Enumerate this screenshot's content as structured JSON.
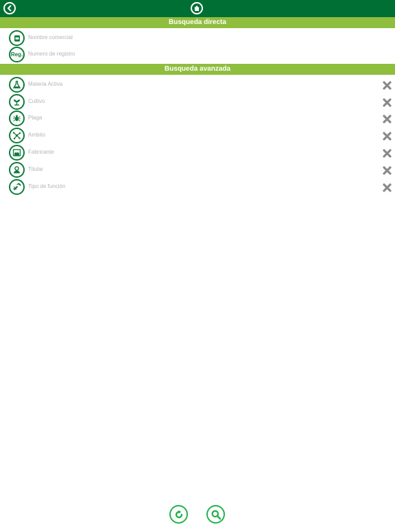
{
  "header": {
    "back_icon": "chevron-left-icon",
    "home_icon": "home-icon"
  },
  "direct_search": {
    "title": "Busqueda directa",
    "fields": [
      {
        "label": "Nombre comercial",
        "icon": "product-icon"
      },
      {
        "label": "Numero de registro",
        "icon": "reg-icon",
        "icon_text": "Reg."
      }
    ]
  },
  "advanced_search": {
    "title": "Busqueda avanzada",
    "fields": [
      {
        "label": "Materia Activa",
        "icon": "flask-icon"
      },
      {
        "label": "Cultivo",
        "icon": "plant-icon"
      },
      {
        "label": "Plaga",
        "icon": "bug-icon"
      },
      {
        "label": "Ambito",
        "icon": "network-icon"
      },
      {
        "label": "Fabricante",
        "icon": "factory-icon"
      },
      {
        "label": "Titular",
        "icon": "user-icon"
      },
      {
        "label": "Tipo de función",
        "icon": "spray-icon"
      }
    ]
  },
  "footer": {
    "reload_icon": "reload-icon",
    "search_icon": "search-icon"
  },
  "colors": {
    "top_bar": "#006f34",
    "section_header": "#8fbd3e",
    "icon_green": "#0f7a3a",
    "footer_green": "#22b14c",
    "clear_gray": "#8a8a8a",
    "label_gray": "#b5b5b5"
  }
}
